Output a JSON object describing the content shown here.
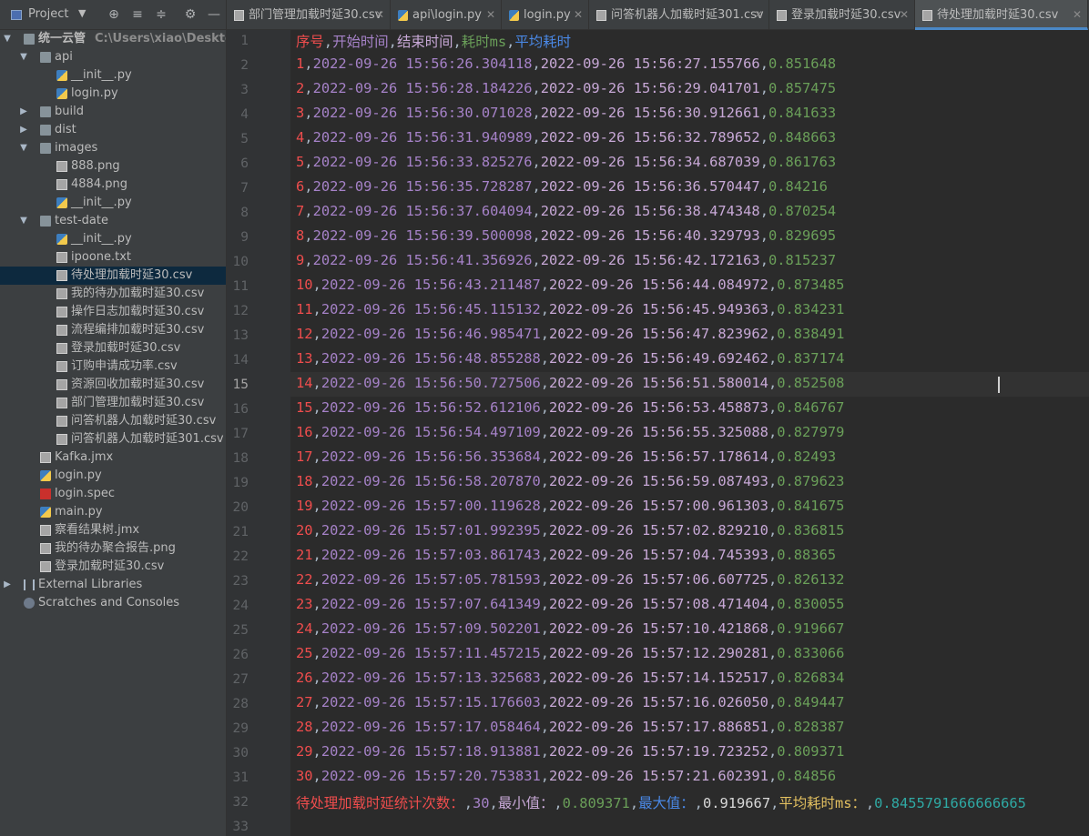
{
  "project_header": {
    "title": "Project"
  },
  "tree": [
    {
      "label": "统一云管",
      "path": "C:\\Users\\xiao\\Desktop\\统一",
      "icon": "folder-icon",
      "arrow": "▼",
      "depth": 0,
      "bold": true
    },
    {
      "label": "api",
      "icon": "package-folder-icon",
      "arrow": "▼",
      "depth": 1
    },
    {
      "label": "__init__.py",
      "icon": "python-file-icon",
      "depth": 2
    },
    {
      "label": "login.py",
      "icon": "python-file-icon",
      "depth": 2
    },
    {
      "label": "build",
      "icon": "folder-icon",
      "arrow": "▶",
      "depth": 1
    },
    {
      "label": "dist",
      "icon": "folder-icon",
      "arrow": "▶",
      "depth": 1
    },
    {
      "label": "images",
      "icon": "package-folder-icon",
      "arrow": "▼",
      "depth": 1
    },
    {
      "label": "888.png",
      "icon": "image-file-icon",
      "depth": 2
    },
    {
      "label": "4884.png",
      "icon": "image-file-icon",
      "depth": 2
    },
    {
      "label": "__init__.py",
      "icon": "python-file-icon",
      "depth": 2
    },
    {
      "label": "test-date",
      "icon": "package-folder-icon",
      "arrow": "▼",
      "depth": 1
    },
    {
      "label": "__init__.py",
      "icon": "python-file-icon",
      "depth": 2
    },
    {
      "label": "ipoone.txt",
      "icon": "text-file-icon",
      "depth": 2
    },
    {
      "label": "待处理加载时延30.csv",
      "icon": "csv-file-icon",
      "depth": 2,
      "selected": true
    },
    {
      "label": "我的待办加载时延30.csv",
      "icon": "csv-file-icon",
      "depth": 2
    },
    {
      "label": "操作日志加载时延30.csv",
      "icon": "csv-file-icon",
      "depth": 2
    },
    {
      "label": "流程编排加载时延30.csv",
      "icon": "csv-file-icon",
      "depth": 2
    },
    {
      "label": "登录加载时延30.csv",
      "icon": "csv-file-icon",
      "depth": 2
    },
    {
      "label": "订购申请成功率.csv",
      "icon": "csv-file-icon",
      "depth": 2
    },
    {
      "label": "资源回收加载时延30.csv",
      "icon": "csv-file-icon",
      "depth": 2
    },
    {
      "label": "部门管理加载时延30.csv",
      "icon": "csv-file-icon",
      "depth": 2
    },
    {
      "label": "问答机器人加载时延30.csv",
      "icon": "csv-file-icon",
      "depth": 2
    },
    {
      "label": "问答机器人加载时延301.csv",
      "icon": "csv-file-icon",
      "depth": 2
    },
    {
      "label": "Kafka.jmx",
      "icon": "jmx-file-icon",
      "depth": 1
    },
    {
      "label": "login.py",
      "icon": "python-file-icon",
      "depth": 1
    },
    {
      "label": "login.spec",
      "icon": "spec-file-icon",
      "depth": 1
    },
    {
      "label": "main.py",
      "icon": "python-file-icon",
      "depth": 1
    },
    {
      "label": "察看结果树.jmx",
      "icon": "jmx-file-icon",
      "depth": 1
    },
    {
      "label": "我的待办聚合报告.png",
      "icon": "image-file-icon",
      "depth": 1
    },
    {
      "label": "登录加载时延30.csv",
      "icon": "csv-file-icon",
      "depth": 1
    },
    {
      "label": "External Libraries",
      "icon": "library-icon",
      "arrow": "▶",
      "depth": 0
    },
    {
      "label": "Scratches and Consoles",
      "icon": "scratch-icon",
      "depth": 0
    }
  ],
  "tabs": [
    {
      "label": "部门管理加载时延30.csv",
      "icon": "csv-file-icon"
    },
    {
      "label": "api\\login.py",
      "icon": "python-file-icon"
    },
    {
      "label": "login.py",
      "icon": "python-file-icon"
    },
    {
      "label": "问答机器人加载时延301.csv",
      "icon": "csv-file-icon"
    },
    {
      "label": "登录加载时延30.csv",
      "icon": "csv-file-icon"
    },
    {
      "label": "待处理加载时延30.csv",
      "icon": "csv-file-icon",
      "active": true
    }
  ],
  "colors": {
    "col1": "#ef4d4d",
    "col2": "#a682c8",
    "col3": "#c7a8d6",
    "col4": "#6a9f59",
    "col5": "#4a88e6",
    "col6": "#d8d8d8",
    "col7": "#e3c060",
    "col8": "#2fa9a4",
    "text": "#a9b7c6",
    "editor_bg": "#2b2b2b"
  },
  "editor": {
    "current_line": 15,
    "header": [
      "序号",
      "开始时间",
      "结束时间",
      "耗时ms",
      "平均耗时"
    ],
    "rows": [
      [
        "1",
        "2022-09-26 15:56:26.304118",
        "2022-09-26 15:56:27.155766",
        "0.851648"
      ],
      [
        "2",
        "2022-09-26 15:56:28.184226",
        "2022-09-26 15:56:29.041701",
        "0.857475"
      ],
      [
        "3",
        "2022-09-26 15:56:30.071028",
        "2022-09-26 15:56:30.912661",
        "0.841633"
      ],
      [
        "4",
        "2022-09-26 15:56:31.940989",
        "2022-09-26 15:56:32.789652",
        "0.848663"
      ],
      [
        "5",
        "2022-09-26 15:56:33.825276",
        "2022-09-26 15:56:34.687039",
        "0.861763"
      ],
      [
        "6",
        "2022-09-26 15:56:35.728287",
        "2022-09-26 15:56:36.570447",
        "0.84216"
      ],
      [
        "7",
        "2022-09-26 15:56:37.604094",
        "2022-09-26 15:56:38.474348",
        "0.870254"
      ],
      [
        "8",
        "2022-09-26 15:56:39.500098",
        "2022-09-26 15:56:40.329793",
        "0.829695"
      ],
      [
        "9",
        "2022-09-26 15:56:41.356926",
        "2022-09-26 15:56:42.172163",
        "0.815237"
      ],
      [
        "10",
        "2022-09-26 15:56:43.211487",
        "2022-09-26 15:56:44.084972",
        "0.873485"
      ],
      [
        "11",
        "2022-09-26 15:56:45.115132",
        "2022-09-26 15:56:45.949363",
        "0.834231"
      ],
      [
        "12",
        "2022-09-26 15:56:46.985471",
        "2022-09-26 15:56:47.823962",
        "0.838491"
      ],
      [
        "13",
        "2022-09-26 15:56:48.855288",
        "2022-09-26 15:56:49.692462",
        "0.837174"
      ],
      [
        "14",
        "2022-09-26 15:56:50.727506",
        "2022-09-26 15:56:51.580014",
        "0.852508"
      ],
      [
        "15",
        "2022-09-26 15:56:52.612106",
        "2022-09-26 15:56:53.458873",
        "0.846767"
      ],
      [
        "16",
        "2022-09-26 15:56:54.497109",
        "2022-09-26 15:56:55.325088",
        "0.827979"
      ],
      [
        "17",
        "2022-09-26 15:56:56.353684",
        "2022-09-26 15:56:57.178614",
        "0.82493"
      ],
      [
        "18",
        "2022-09-26 15:56:58.207870",
        "2022-09-26 15:56:59.087493",
        "0.879623"
      ],
      [
        "19",
        "2022-09-26 15:57:00.119628",
        "2022-09-26 15:57:00.961303",
        "0.841675"
      ],
      [
        "20",
        "2022-09-26 15:57:01.992395",
        "2022-09-26 15:57:02.829210",
        "0.836815"
      ],
      [
        "21",
        "2022-09-26 15:57:03.861743",
        "2022-09-26 15:57:04.745393",
        "0.88365"
      ],
      [
        "22",
        "2022-09-26 15:57:05.781593",
        "2022-09-26 15:57:06.607725",
        "0.826132"
      ],
      [
        "23",
        "2022-09-26 15:57:07.641349",
        "2022-09-26 15:57:08.471404",
        "0.830055"
      ],
      [
        "24",
        "2022-09-26 15:57:09.502201",
        "2022-09-26 15:57:10.421868",
        "0.919667"
      ],
      [
        "25",
        "2022-09-26 15:57:11.457215",
        "2022-09-26 15:57:12.290281",
        "0.833066"
      ],
      [
        "26",
        "2022-09-26 15:57:13.325683",
        "2022-09-26 15:57:14.152517",
        "0.826834"
      ],
      [
        "27",
        "2022-09-26 15:57:15.176603",
        "2022-09-26 15:57:16.026050",
        "0.849447"
      ],
      [
        "28",
        "2022-09-26 15:57:17.058464",
        "2022-09-26 15:57:17.886851",
        "0.828387"
      ],
      [
        "29",
        "2022-09-26 15:57:18.913881",
        "2022-09-26 15:57:19.723252",
        "0.809371"
      ],
      [
        "30",
        "2022-09-26 15:57:20.753831",
        "2022-09-26 15:57:21.602391",
        "0.84856"
      ]
    ],
    "summary": [
      "待处理加载时延统计次数：",
      "30",
      "最小值：",
      "0.809371",
      "最大值：",
      "0.919667",
      "平均耗时ms：",
      "0.8455791666666665"
    ],
    "line_numbers": [
      "1",
      "2",
      "3",
      "4",
      "5",
      "6",
      "7",
      "8",
      "9",
      "10",
      "11",
      "12",
      "13",
      "14",
      "15",
      "16",
      "17",
      "18",
      "19",
      "20",
      "21",
      "22",
      "23",
      "24",
      "25",
      "26",
      "27",
      "28",
      "29",
      "30",
      "31",
      "32",
      "33"
    ]
  }
}
